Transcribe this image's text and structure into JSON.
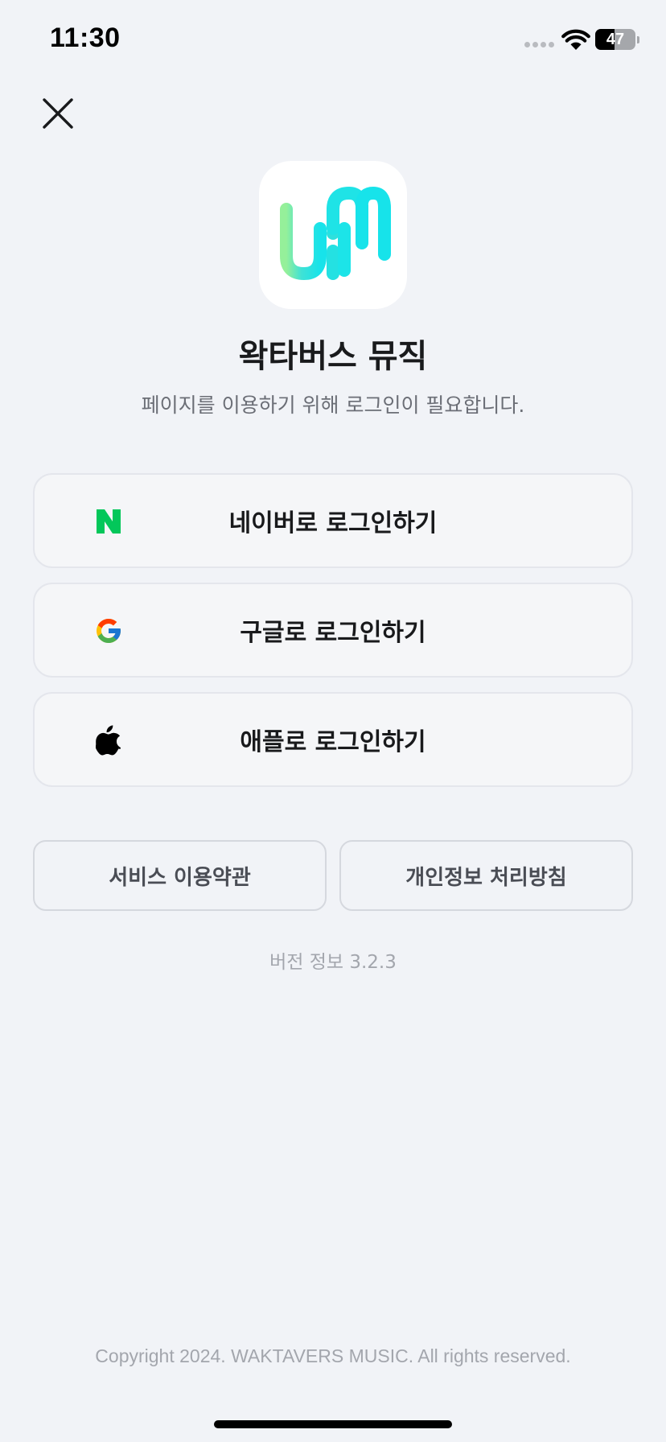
{
  "status_bar": {
    "time": "11:30",
    "battery_level": "47"
  },
  "colors": {
    "background": "#f1f3f7",
    "naver": "#03c75a",
    "logo_gradient": [
      "#8ef09c",
      "#36dfe0",
      "#1de6e8"
    ]
  },
  "close": {
    "icon": "close-icon"
  },
  "app": {
    "logo_icon": "waktaverse-music-logo-icon",
    "title": "왁타버스 뮤직",
    "subtitle": "페이지를 이용하기 위해 로그인이 필요합니다."
  },
  "login_buttons": [
    {
      "icon": "naver-icon",
      "label": "네이버로 로그인하기"
    },
    {
      "icon": "google-icon",
      "label": "구글로 로그인하기"
    },
    {
      "icon": "apple-icon",
      "label": "애플로 로그인하기"
    }
  ],
  "policies": {
    "terms_label": "서비스 이용약관",
    "privacy_label": "개인정보 처리방침"
  },
  "version": "버전 정보 3.2.3",
  "copyright": "Copyright 2024. WAKTAVERS MUSIC. All rights reserved."
}
